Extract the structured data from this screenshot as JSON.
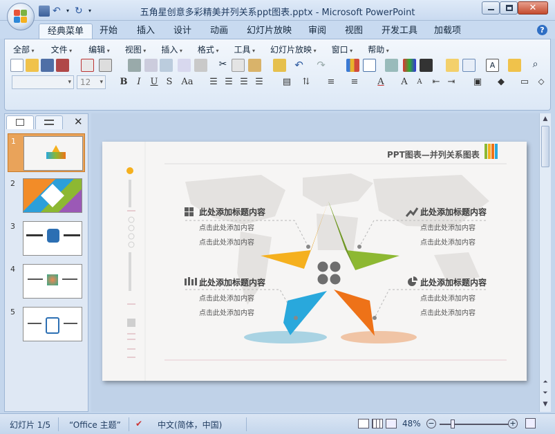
{
  "window": {
    "title": "五角星创意多彩精美并列关系ppt图表.pptx - Microsoft PowerPoint"
  },
  "tabs": [
    "经典菜单",
    "开始",
    "插入",
    "设计",
    "动画",
    "幻灯片放映",
    "审阅",
    "视图",
    "开发工具",
    "加载项"
  ],
  "active_tab": "经典菜单",
  "menu": [
    "全部",
    "文件",
    "编辑",
    "视图",
    "插入",
    "格式",
    "工具",
    "幻灯片放映",
    "窗口",
    "帮助"
  ],
  "font_size_value": "12",
  "slides_count": 5,
  "selected_slide": "1",
  "slide": {
    "header": "PPT图表—并列关系图表",
    "blocks": [
      {
        "title": "此处添加标题内容",
        "line1": "点击此处添加内容",
        "line2": "点击此处添加内容"
      },
      {
        "title": "此处添加标题内容",
        "line1": "点击此处添加内容",
        "line2": "点击此处添加内容"
      },
      {
        "title": "此处添加标题内容",
        "line1": "点击此处添加内容",
        "line2": "点击此处添加内容"
      },
      {
        "title": "此处添加标题内容",
        "line1": "点击此处添加内容",
        "line2": "点击此处添加内容"
      }
    ],
    "colors": {
      "yellow": "#f5b01e",
      "green": "#8db832",
      "blue": "#29a8dc",
      "orange": "#ee7218",
      "gray": "#6e6e6e"
    }
  },
  "status": {
    "slide": "幻灯片 1/5",
    "theme": "“Office 主题”",
    "language": "中文(简体，中国)",
    "zoom": "48%"
  },
  "icons": {
    "help": "help-icon",
    "close": "close-icon"
  }
}
